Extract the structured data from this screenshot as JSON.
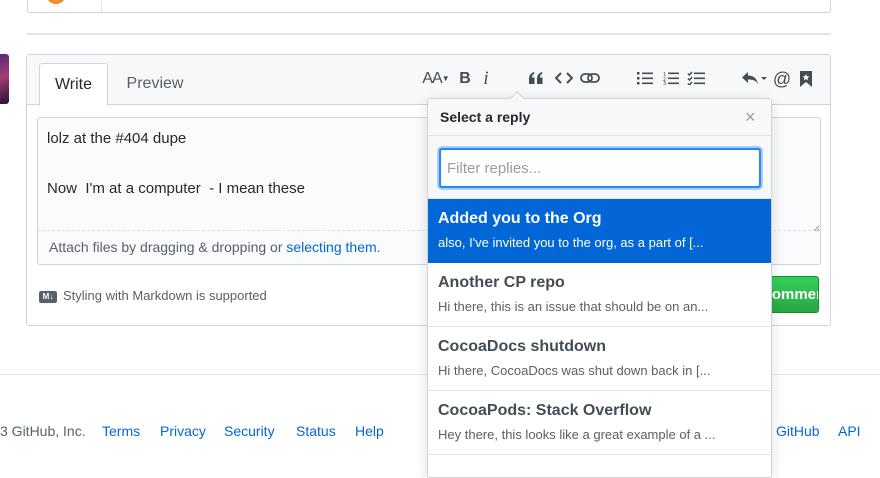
{
  "editor": {
    "tabs": {
      "write": "Write",
      "preview": "Preview"
    },
    "text_lines": [
      "lolz at the #404 dupe",
      "Now  I'm at a computer  - I mean these"
    ],
    "attach_prefix": "Attach files by dragging & dropping or ",
    "attach_link": "selecting them",
    "attach_suffix": ".",
    "markdown_badge": "M↓",
    "markdown_note": "Styling with Markdown is supported",
    "submit_label": "Comment",
    "toolbar": {
      "heading": "AA",
      "bold": "B",
      "italic": "i",
      "icons": [
        "text-size-icon",
        "bold-icon",
        "italic-icon",
        "quote-icon",
        "code-icon",
        "link-icon",
        "bullet-list-icon",
        "numbered-list-icon",
        "task-list-icon",
        "reply-icon",
        "mention-icon",
        "bookmark-icon"
      ]
    }
  },
  "saved_replies": {
    "title": "Select a reply",
    "close": "×",
    "filter_placeholder": "Filter replies...",
    "items": [
      {
        "title": "Added you to the Org",
        "body": "also, I've invited you to the org, as a part of [...",
        "selected": true
      },
      {
        "title": "Another CP repo",
        "body": "Hi there, this is an issue that should be on an...",
        "selected": false
      },
      {
        "title": "CocoaDocs shutdown",
        "body": "Hi there, CocoaDocs was shut down back in [...",
        "selected": false
      },
      {
        "title": "CocoaPods: Stack Overflow",
        "body": "Hey there, this looks like a great example of a ...",
        "selected": false
      }
    ]
  },
  "footer": {
    "copyright": "3 GitHub, Inc.",
    "links": [
      "Terms",
      "Privacy",
      "Security",
      "Status",
      "Help"
    ],
    "right_links": [
      "GitHub",
      "API"
    ]
  },
  "colors": {
    "accent": "#0366d6",
    "submit": "#28a745",
    "selected_bg": "#0366d6"
  }
}
